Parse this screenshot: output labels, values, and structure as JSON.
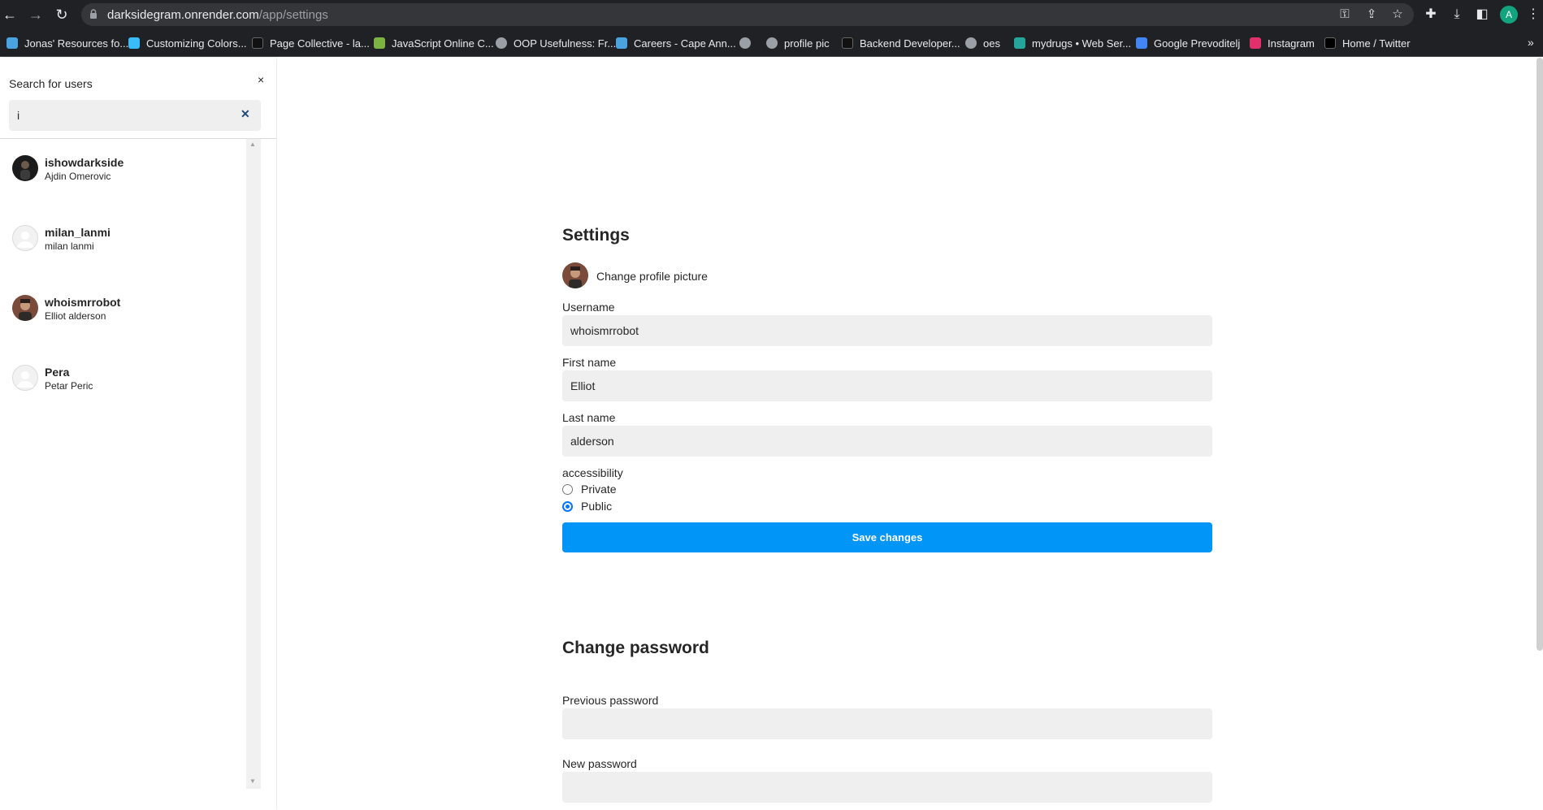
{
  "browser": {
    "url_host": "darksidegram.onrender.com",
    "url_path": "/app/settings",
    "profile_initial": "A",
    "bookmarks": [
      {
        "label": "Jonas' Resources fo...",
        "color": "#4aa3df"
      },
      {
        "label": "Customizing Colors...",
        "color": "#38bdf8"
      },
      {
        "label": "Page Collective - la...",
        "color": "#111111"
      },
      {
        "label": "JavaScript Online C...",
        "color": "#7cb342"
      },
      {
        "label": "OOP Usefulness: Fr...",
        "color": "#9aa0a6"
      },
      {
        "label": "Careers - Cape Ann...",
        "color": "#4aa3df"
      },
      {
        "label": "",
        "color": "#9aa0a6"
      },
      {
        "label": "profile pic",
        "color": "#9aa0a6"
      },
      {
        "label": "Backend Developer...",
        "color": "#111111"
      },
      {
        "label": "oes",
        "color": "#9aa0a6"
      },
      {
        "label": "mydrugs • Web Ser...",
        "color": "#26a69a"
      },
      {
        "label": "Google Prevoditelj",
        "color": "#4285f4"
      },
      {
        "label": "Instagram",
        "color": "#e1306c"
      },
      {
        "label": "Home / Twitter",
        "color": "#000000"
      }
    ]
  },
  "sidebar": {
    "title": "Search for users",
    "close_glyph": "×",
    "search_value": "i",
    "clear_glyph": "✕",
    "users": [
      {
        "username": "ishowdarkside",
        "full_name": "Ajdin Omerovic",
        "avatar": "photo-dark"
      },
      {
        "username": "milan_lanmi",
        "full_name": "milan lanmi",
        "avatar": "blank"
      },
      {
        "username": "whoismrrobot",
        "full_name": "Elliot alderson",
        "avatar": "photo"
      },
      {
        "username": "Pera",
        "full_name": "Petar Peric",
        "avatar": "blank"
      }
    ]
  },
  "settings": {
    "title": "Settings",
    "change_picture": "Change profile picture",
    "username_label": "Username",
    "username_value": "whoismrrobot",
    "first_name_label": "First name",
    "first_name_value": "Elliot",
    "last_name_label": "Last name",
    "last_name_value": "alderson",
    "accessibility_label": "accessibility",
    "option_private": "Private",
    "option_public": "Public",
    "selected_option": "Public",
    "save_label": "Save changes"
  },
  "password": {
    "title": "Change password",
    "previous_label": "Previous password",
    "new_label": "New password"
  },
  "colors": {
    "primary_button": "#0095f6",
    "field_bg": "#efefef",
    "chrome_bg": "#202124"
  }
}
